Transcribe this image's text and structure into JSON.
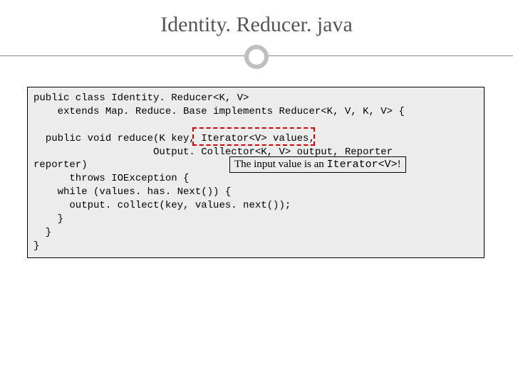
{
  "title": "Identity. Reducer. java",
  "code": {
    "l1": "public class Identity. Reducer<K, V>",
    "l2": "    extends Map. Reduce. Base implements Reducer<K, V, K, V> {",
    "l3": "",
    "l4": "  public void reduce(K key, Iterator<V> values,",
    "l5": "                    Output. Collector<K, V> output, Reporter",
    "l6": "reporter)",
    "l7": "      throws IOException {",
    "l8": "    while (values. has. Next()) {",
    "l9": "      output. collect(key, values. next());",
    "l10": "    }",
    "l11": "  }",
    "l12": "}"
  },
  "callout": {
    "prefix": "The input value is an ",
    "code": "Iterator<V>",
    "suffix": "!"
  }
}
